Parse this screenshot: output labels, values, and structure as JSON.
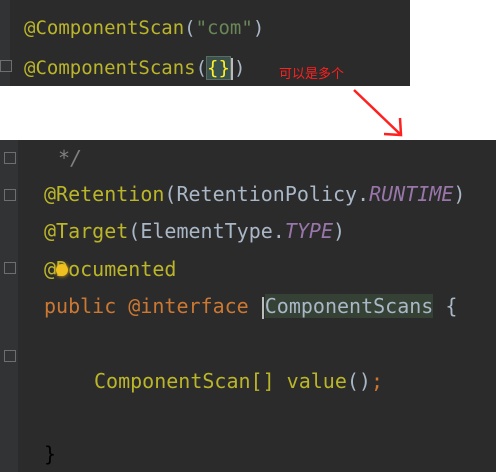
{
  "top_editor": {
    "line1": {
      "annotation": "@ComponentScan",
      "open": "(",
      "value": "\"com\"",
      "close": ")"
    },
    "line2": {
      "annotation": "@ComponentScans",
      "open": "(",
      "braces": "{}",
      "close": ")"
    }
  },
  "callout": {
    "text": "可以是多个",
    "color": "#ff2020"
  },
  "bottom_editor": {
    "comment": "*/",
    "retention": {
      "annotation": "@Retention",
      "open": "(",
      "arg_class": "RetentionPolicy.",
      "arg_const": "RUNTIME",
      "close": ")"
    },
    "target": {
      "annotation": "@Target",
      "open": "(",
      "arg_class": "ElementType.",
      "arg_const": "TYPE",
      "close": ")"
    },
    "documented": {
      "at": "@",
      "rest": "Documented"
    },
    "declaration": {
      "modifier": "public",
      "keyword": "@interface",
      "name": "ComponentScans",
      "brace": "{"
    },
    "method": {
      "type": "ComponentScan[]",
      "name": "value",
      "parens": "()",
      "semicolon": ";"
    },
    "closing": "}"
  },
  "colors": {
    "editor_bg": "#2b2b2b",
    "annotation": "#bbb529",
    "keyword": "#cc7832",
    "string": "#6a8759",
    "constant": "#9876aa",
    "text": "#a9b7c6"
  }
}
